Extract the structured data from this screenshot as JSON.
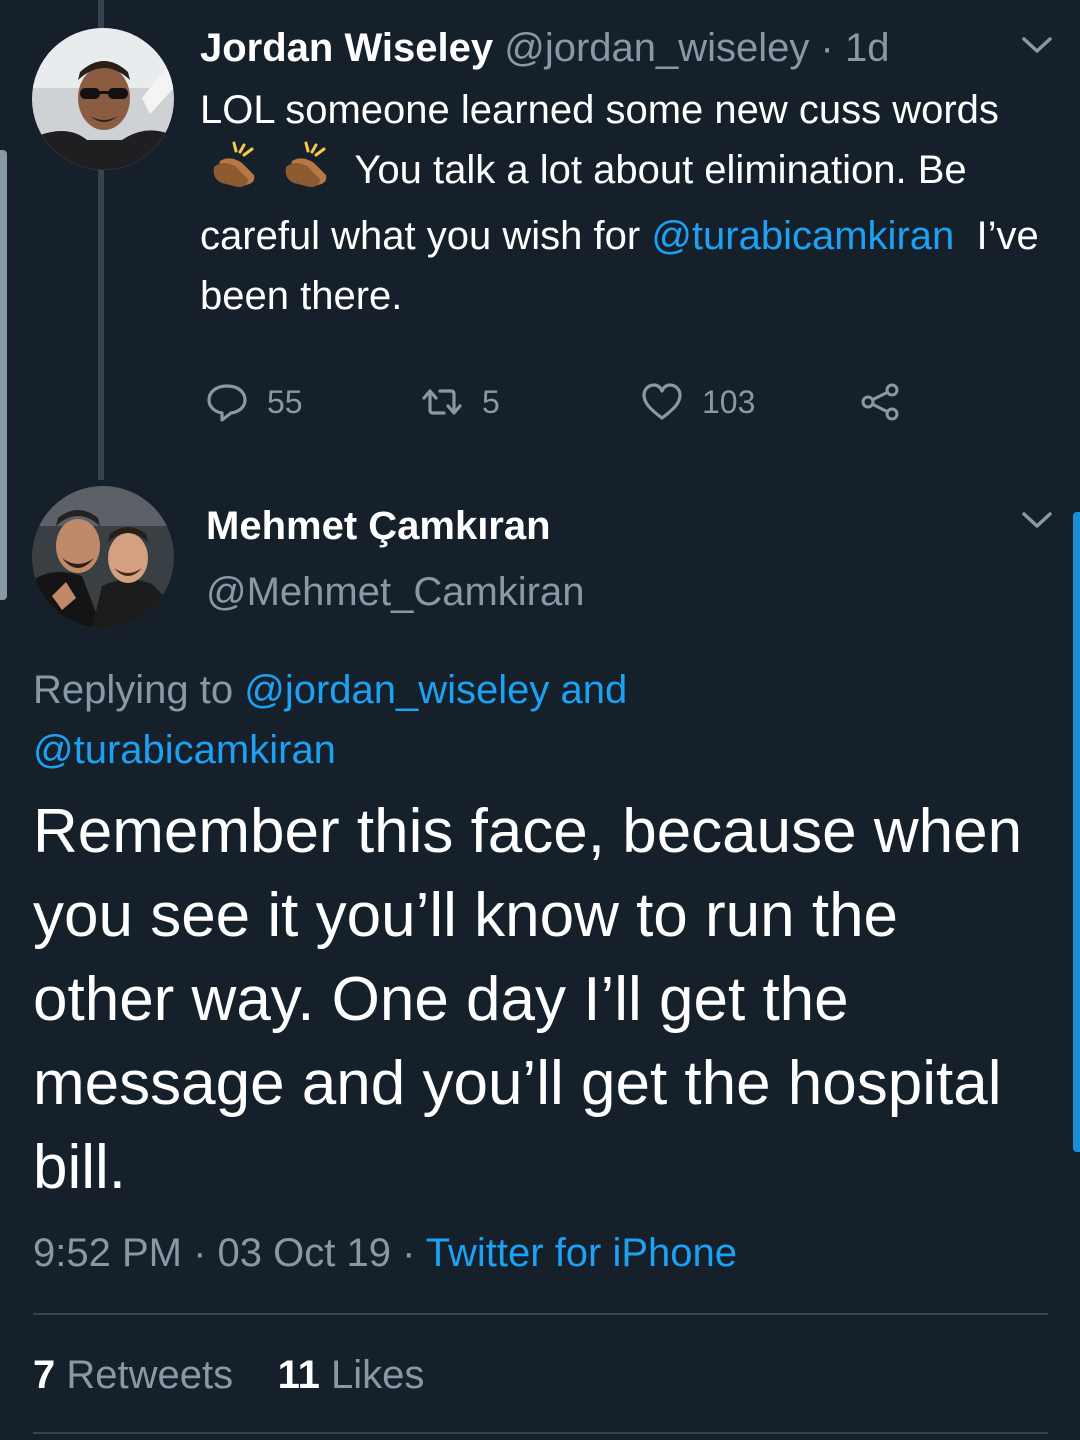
{
  "colors": {
    "background": "#15202b",
    "text": "#ffffff",
    "muted": "#8899a6",
    "link": "#1da1f2",
    "divider": "#38444d"
  },
  "tweet1": {
    "name": "Jordan Wiseley",
    "handle": "@jordan_wiseley",
    "sep": " · ",
    "time": "1d",
    "text_a": "LOL someone learned some new cuss words",
    "text_b": "You talk a lot about elimination. Be careful what you wish for",
    "mention": "@turabicamkiran",
    "text_c": "I’ve been there.",
    "replies": "55",
    "retweets": "5",
    "likes": "103",
    "icons": {
      "reply": "reply-icon",
      "retweet": "retweet-icon",
      "like": "heart-icon",
      "share": "share-icon",
      "clap": "clapping-hands-emoji",
      "menu": "chevron-down-icon"
    }
  },
  "tweet2": {
    "name": "Mehmet Çamkıran",
    "handle": "@Mehmet_Camkiran",
    "replying_prefix": "Replying to ",
    "replying_user1": "@jordan_wiseley",
    "replying_and": " and",
    "replying_user2": "@turabicamkiran",
    "body": "Remember this face, because when you see it you’ll know to run the other way. One day I’ll get the message and you’ll get the hospital bill.",
    "time": "9:52 PM",
    "sep": " · ",
    "date": "03 Oct 19",
    "source": "Twitter for iPhone",
    "retweet_count": "7",
    "retweet_label": "Retweets",
    "like_count": "11",
    "like_label": "Likes"
  }
}
